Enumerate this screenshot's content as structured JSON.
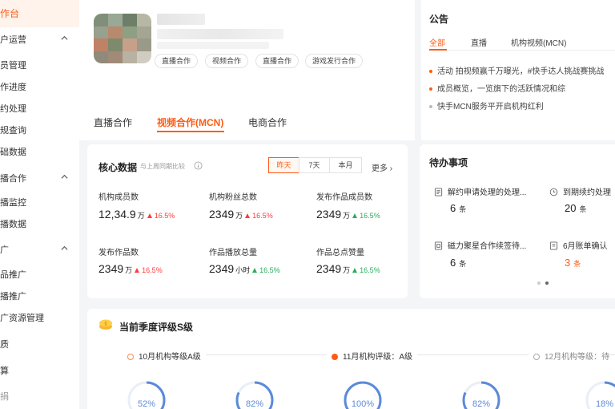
{
  "sidebar": {
    "items": [
      {
        "label": "作台",
        "kind": "active"
      },
      {
        "label": "户运营",
        "kind": "group"
      },
      {
        "label": "员管理",
        "kind": "item"
      },
      {
        "label": "作进度",
        "kind": "item"
      },
      {
        "label": "约处理",
        "kind": "item"
      },
      {
        "label": "规查询",
        "kind": "item"
      },
      {
        "label": "础数据",
        "kind": "item"
      },
      {
        "label": "播合作",
        "kind": "group"
      },
      {
        "label": "播监控",
        "kind": "item"
      },
      {
        "label": "播数据",
        "kind": "item"
      },
      {
        "label": "广",
        "kind": "group"
      },
      {
        "label": "品推广",
        "kind": "item"
      },
      {
        "label": "播推广",
        "kind": "item"
      },
      {
        "label": "广资源管理",
        "kind": "item"
      },
      {
        "label": "质",
        "kind": "item"
      },
      {
        "label": "算",
        "kind": "item"
      },
      {
        "label": "捐",
        "kind": "item"
      }
    ]
  },
  "profile": {
    "tags": [
      "直播合作",
      "视频合作",
      "直播合作",
      "游戏发行合作"
    ]
  },
  "tabs": [
    "直播合作",
    "视频合作(MCN)",
    "电商合作"
  ],
  "announcement": {
    "title": "公告",
    "tabs": [
      "全部",
      "直播",
      "机构视频(MCN)"
    ],
    "items": [
      "活动 拍视频赢千万曝光，#快手达人挑战赛挑战",
      "成员概览，一览旗下的活跃情况和综",
      "快手MCN服务平开启机构红利"
    ]
  },
  "core": {
    "title": "核心数据",
    "subtitle": "与上周同期比较",
    "periods": [
      "昨天",
      "7天",
      "本月"
    ],
    "more": "更多",
    "metrics": [
      {
        "label": "机构成员数",
        "value": "12,34.9",
        "unit": "万",
        "change": "16.5%",
        "dir": "up-red"
      },
      {
        "label": "机构粉丝总数",
        "value": "2349",
        "unit": "万",
        "change": "16.5%",
        "dir": "up-red"
      },
      {
        "label": "发布作品成员数",
        "value": "2349",
        "unit": "万",
        "change": "16.5%",
        "dir": "up-green"
      },
      {
        "label": "发布作品数",
        "value": "2349",
        "unit": "万",
        "change": "16.5%",
        "dir": "up-red"
      },
      {
        "label": "作品播放总量",
        "value": "2349",
        "unit": "小时",
        "change": "16.5%",
        "dir": "up-green"
      },
      {
        "label": "作品总点赞量",
        "value": "2349",
        "unit": "万",
        "change": "16.5%",
        "dir": "up-green"
      }
    ]
  },
  "todo": {
    "title": "待办事项",
    "items": [
      {
        "label": "解约申请处理的处理...",
        "count": "6",
        "unit": "条",
        "icon": "document-icon"
      },
      {
        "label": "到期续约处理",
        "count": "20",
        "unit": "条",
        "icon": "clock-icon"
      },
      {
        "label": "磁力聚星合作续签待...",
        "count": "6",
        "unit": "条",
        "icon": "contract-icon"
      },
      {
        "label": "6月账单确认",
        "count": "3",
        "unit": "条",
        "icon": "bill-icon",
        "highlight": true
      }
    ]
  },
  "rating": {
    "title": "当前季度评级S级",
    "timeline": [
      "10月机构等级A级",
      "11月机构评级：A级",
      "12月机构等级：待"
    ],
    "gauges": [
      {
        "label": "52%",
        "value": 0.52
      },
      {
        "label": "82%",
        "value": 0.82
      },
      {
        "label": "100%",
        "value": 1.0
      },
      {
        "label": "82%",
        "value": 0.82
      },
      {
        "label": "18%",
        "value": 0.18
      }
    ]
  },
  "colors": {
    "accent": "#ff5b14",
    "up_red": "#ff3b3b",
    "up_green": "#2aae5e",
    "gauge": "#5b8ad9"
  }
}
